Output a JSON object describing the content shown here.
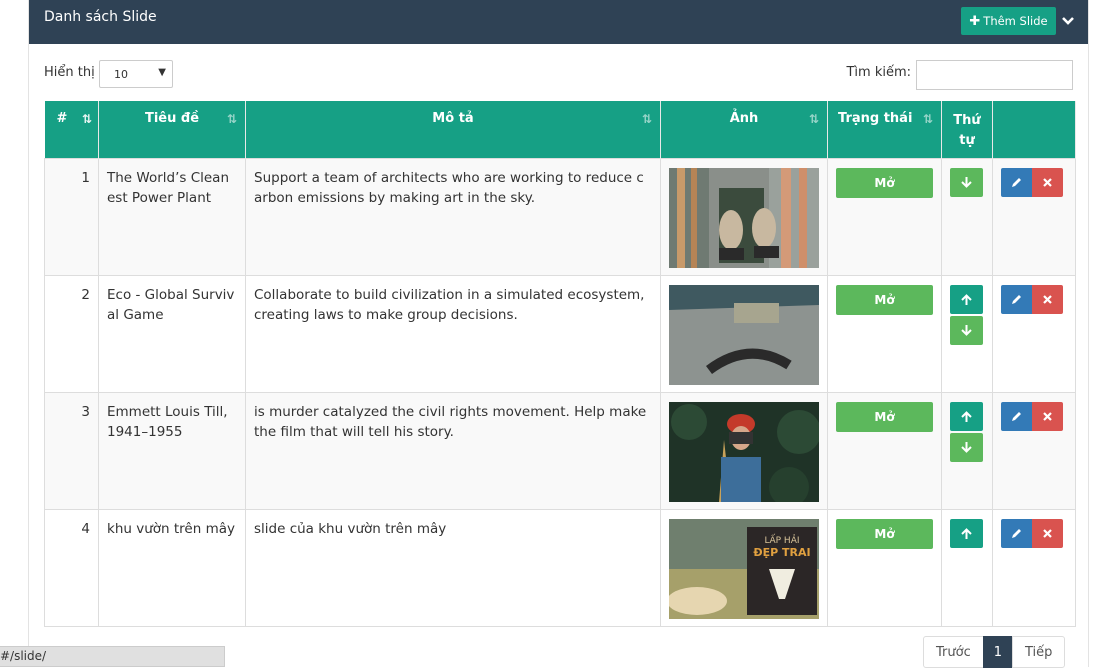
{
  "panel": {
    "title": "Danh sách Slide",
    "add_label": "Thêm Slide"
  },
  "controls": {
    "show_label": "Hiển thị",
    "page_size": "10",
    "search_label": "Tìm kiếm:",
    "search_value": ""
  },
  "table": {
    "headers": [
      "#",
      "Tiêu đề",
      "Mô tả",
      "Ảnh",
      "Trạng thái",
      "Thứ tự",
      ""
    ],
    "rows": [
      {
        "num": "1",
        "title": "The World’s Cleanest Power Plant",
        "desc": "Support a team of architects who are working to reduce carbon emissions by making art in the sky.",
        "status": "Mở"
      },
      {
        "num": "2",
        "title": "Eco - Global Survival Game",
        "desc": "Collaborate to build civilization in a simulated ecosystem, creating laws to make group decisions.",
        "status": "Mở"
      },
      {
        "num": "3",
        "title": "Emmett Louis Till, 1941–1955",
        "desc": "is murder catalyzed the civil rights movement. Help make the film that will tell his story.",
        "status": "Mở"
      },
      {
        "num": "4",
        "title": "khu vườn trên mây",
        "desc": "slide của khu vườn trên mây",
        "status": "Mở"
      }
    ]
  },
  "book_text": {
    "line1": "LẤP HẢI",
    "line2": "ĐẸP TRAI"
  },
  "status_bar": "#/slide/",
  "pagination": {
    "prev": "Trước",
    "page": "1",
    "next": "Tiếp"
  },
  "colors": {
    "header": "#2f4255",
    "teal": "#16a085",
    "green": "#5cb85c",
    "blue": "#337ab7",
    "red": "#d9534f"
  }
}
